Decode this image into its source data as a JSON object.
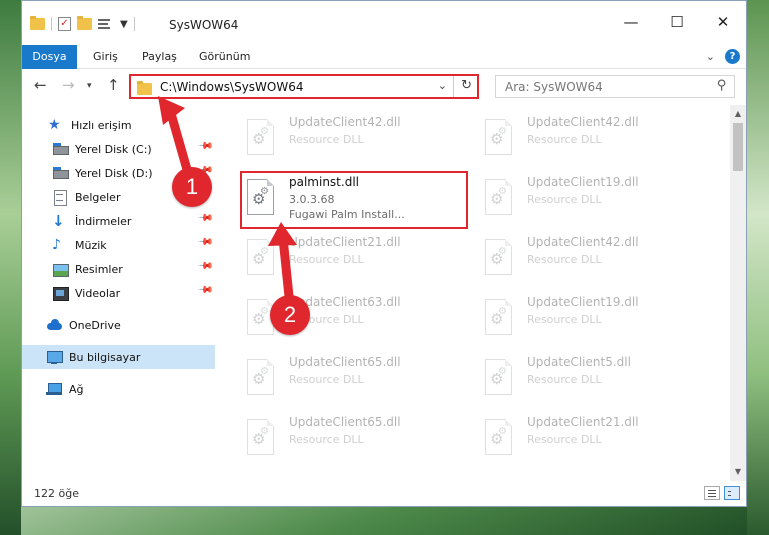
{
  "window": {
    "title": "SysWOW64",
    "controls": {
      "minimize": "—",
      "maximize": "☐",
      "close": "✕"
    }
  },
  "ribbon": {
    "tabs": [
      "Dosya",
      "Giriş",
      "Paylaş",
      "Görünüm"
    ],
    "help": "?"
  },
  "navbar": {
    "address": "C:\\Windows\\SysWOW64",
    "search_placeholder": "Ara: SysWOW64"
  },
  "sidebar": {
    "items": [
      {
        "label": "Hızlı erişim",
        "icon": "star-icon",
        "pinned": false
      },
      {
        "label": "Yerel Disk (C:)",
        "icon": "drive-icon",
        "pinned": true
      },
      {
        "label": "Yerel Disk (D:)",
        "icon": "drive-icon",
        "pinned": true
      },
      {
        "label": "Belgeler",
        "icon": "documents-icon",
        "pinned": false
      },
      {
        "label": "İndirmeler",
        "icon": "downloads-icon",
        "pinned": true
      },
      {
        "label": "Müzik",
        "icon": "music-icon",
        "pinned": true
      },
      {
        "label": "Resimler",
        "icon": "pictures-icon",
        "pinned": true
      },
      {
        "label": "Videolar",
        "icon": "videos-icon",
        "pinned": true
      },
      {
        "label": "OneDrive",
        "icon": "onedrive-icon",
        "pinned": false
      },
      {
        "label": "Bu bilgisayar",
        "icon": "this-pc-icon",
        "pinned": false,
        "selected": true
      },
      {
        "label": "Ağ",
        "icon": "network-icon",
        "pinned": false
      }
    ]
  },
  "files": {
    "left_column": [
      {
        "name": "UpdateClient42.dll",
        "type": "Resource DLL",
        "dim": true
      },
      {
        "name": "palminst.dll",
        "version": "3.0.3.68",
        "description": "Fugawi Palm Install...",
        "dim": false,
        "highlighted": true
      },
      {
        "name": "UpdateClient21.dll",
        "type": "Resource DLL",
        "dim": true
      },
      {
        "name": "UpdateClient63.dll",
        "type": "Resource DLL",
        "dim": true
      },
      {
        "name": "UpdateClient65.dll",
        "type": "Resource DLL",
        "dim": true
      },
      {
        "name": "UpdateClient65.dll",
        "type": "Resource DLL",
        "dim": true
      }
    ],
    "right_column": [
      {
        "name": "UpdateClient42.dll",
        "type": "Resource DLL",
        "dim": true
      },
      {
        "name": "UpdateClient19.dll",
        "type": "Resource DLL",
        "dim": true
      },
      {
        "name": "UpdateClient42.dll",
        "type": "Resource DLL",
        "dim": true
      },
      {
        "name": "UpdateClient19.dll",
        "type": "Resource DLL",
        "dim": true
      },
      {
        "name": "UpdateClient5.dll",
        "type": "Resource DLL",
        "dim": true
      },
      {
        "name": "UpdateClient21.dll",
        "type": "Resource DLL",
        "dim": true
      }
    ]
  },
  "status": {
    "item_count": "122 öğe"
  },
  "callouts": [
    "1",
    "2"
  ],
  "colors": {
    "accent": "#1979ca",
    "highlight": "#e0272e",
    "selected": "#cce4f7"
  }
}
